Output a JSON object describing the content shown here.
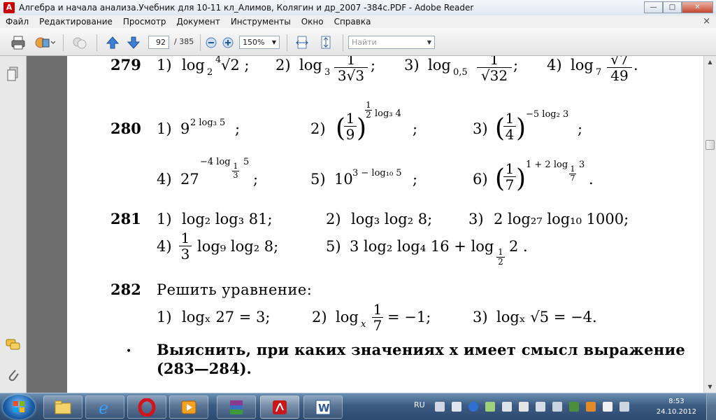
{
  "window": {
    "title": "Алгебра и начала анализа.Учебник для 10-11 кл_Алимов, Колягин и др_2007 -384с.PDF - Adobe Reader",
    "minimize": "—",
    "maximize": "□",
    "close": "✕"
  },
  "menu": {
    "items": [
      "Файл",
      "Редактирование",
      "Просмотр",
      "Документ",
      "Инструменты",
      "Окно",
      "Справка"
    ],
    "close": "×"
  },
  "toolbar": {
    "page_current": "92",
    "page_total": "/ 385",
    "zoom": "150%",
    "search_placeholder": "Найти"
  },
  "content": {
    "p279": {
      "number": "279",
      "i1": "1)",
      "i2": "2)",
      "i3": "3)",
      "i4": "4)",
      "e1_log": "log",
      "e1_base": "2",
      "e1_root_index": "4",
      "e1_arg": "√2 ;",
      "e2_log": "log",
      "e2_base": "3",
      "e2_num": "1",
      "e2_den": "3√3",
      "e2_end": ";",
      "e3_log": "log",
      "e3_base": "0,5",
      "e3_num": "1",
      "e3_den": "√32",
      "e3_end": ";",
      "e4_log": "log",
      "e4_base": "7",
      "e4_num": "√7",
      "e4_den": "49",
      "e4_end": "."
    },
    "p280": {
      "number": "280",
      "i1": "1)",
      "i2": "2)",
      "i3": "3)",
      "i4": "4)",
      "i5": "5)",
      "i6": "6)",
      "e1_base": "9",
      "e1_exp": "2 log₃ 5",
      "e1_end": ";",
      "e2_num": "1",
      "e2_den": "9",
      "e2_exp_num": "1",
      "e2_exp_den": "2",
      "e2_exp": "log₃ 4",
      "e2_end": ";",
      "e3_num": "1",
      "e3_den": "4",
      "e3_exp": "−5 log₂ 3",
      "e3_end": ";",
      "e4_base": "27",
      "e4_exp": "−4 log",
      "e4_exp_num": "1",
      "e4_exp_den": "3",
      "e4_exp_arg": "5",
      "e4_end": ";",
      "e5_base": "10",
      "e5_exp": "3 − log₁₀ 5",
      "e5_end": ";",
      "e6_num": "1",
      "e6_den": "7",
      "e6_exp": "1 + 2 log",
      "e6_exp_num": "1",
      "e6_exp_den": "7",
      "e6_exp_arg": "3",
      "e6_end": "."
    },
    "p281": {
      "number": "281",
      "i1": "1)",
      "i2": "2)",
      "i3": "3)",
      "i4": "4)",
      "i5": "5)",
      "e1": "log₂ log₃ 81;",
      "e2": "log₃ log₂ 8;",
      "e3": "2 log₂₇ log₁₀ 1000;",
      "e4_num": "1",
      "e4_den": "3",
      "e4": "log₉ log₂ 8;",
      "e5": "3 log₂ log₄ 16 + log",
      "e5_sub_num": "1",
      "e5_sub_den": "2",
      "e5_end": "2 ."
    },
    "p282": {
      "number": "282",
      "heading": "Решить уравнение:",
      "i1": "1)",
      "i2": "2)",
      "i3": "3)",
      "e1": "logₓ 27 = 3;",
      "e2_log": "log",
      "e2_x": "x",
      "e2_num": "1",
      "e2_den": "7",
      "e2_end": "= −1;",
      "e3": "logₓ √5 = −4."
    },
    "instruction": {
      "line1": "Выяснить, при каких значениях x имеет смысл выражение",
      "line2": "(283—284)."
    }
  },
  "taskbar": {
    "lang": "RU",
    "time": "8:53",
    "date": "24.10.2012"
  }
}
